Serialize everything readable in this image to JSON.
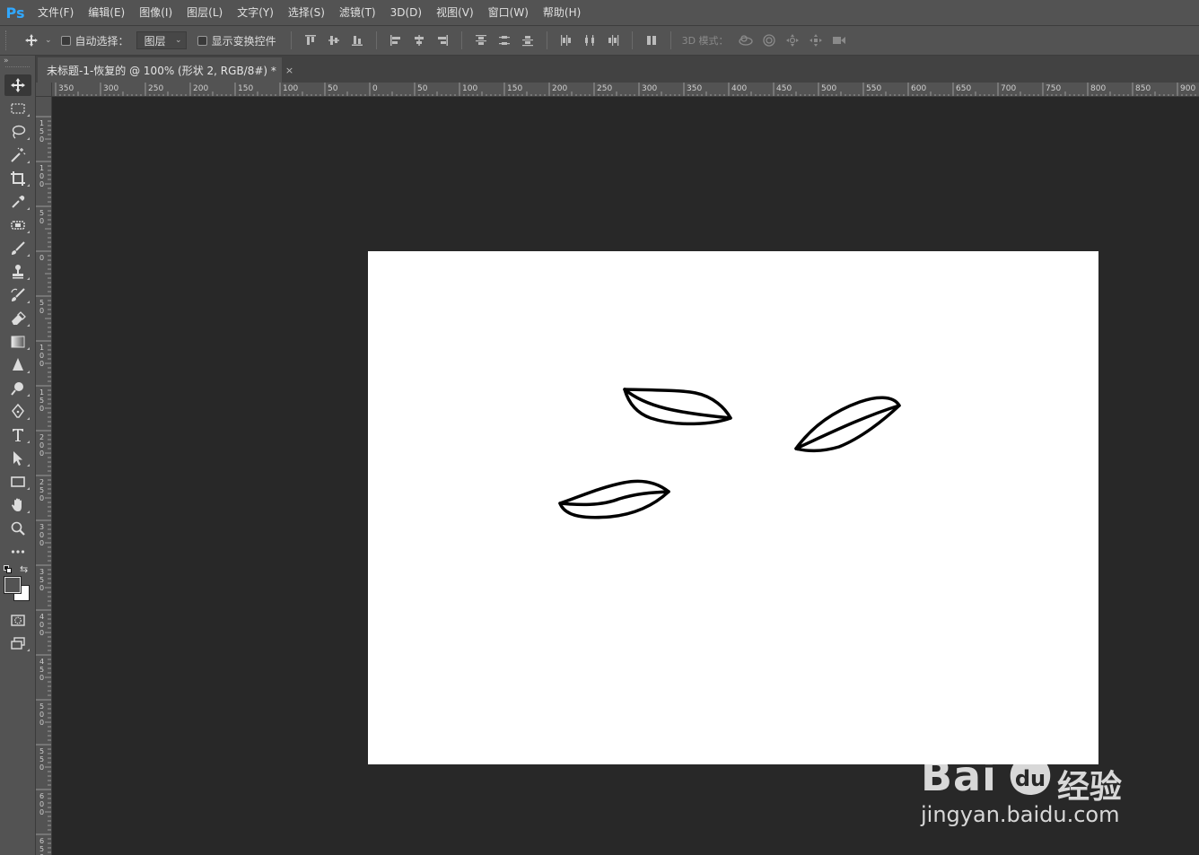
{
  "app": {
    "logo": "Ps"
  },
  "menu": [
    "文件(F)",
    "编辑(E)",
    "图像(I)",
    "图层(L)",
    "文字(Y)",
    "选择(S)",
    "滤镜(T)",
    "3D(D)",
    "视图(V)",
    "窗口(W)",
    "帮助(H)"
  ],
  "options": {
    "auto_select_label": "自动选择：",
    "auto_select_value": "图层",
    "show_transform_label": "显示变换控件",
    "mode_3d_label": "3D 模式："
  },
  "document_tab": {
    "title": "未标题-1-恢复的 @ 100% (形状 2, RGB/8#) *",
    "close": "×"
  },
  "ruler": {
    "h_labels": [
      "350",
      "300",
      "250",
      "200",
      "150",
      "100",
      "50",
      "0",
      "50",
      "100",
      "150",
      "200",
      "250",
      "300",
      "350",
      "400",
      "450",
      "500",
      "550",
      "600",
      "650",
      "700",
      "750",
      "800",
      "850",
      "900"
    ],
    "v_labels": [
      "150",
      "100",
      "50",
      "0",
      "50",
      "100",
      "150",
      "200",
      "250",
      "300",
      "350",
      "400",
      "450",
      "500",
      "550",
      "600",
      "650"
    ]
  },
  "toolbar": {
    "tools": [
      "move-tool",
      "rectangular-marquee-tool",
      "lasso-tool",
      "magic-wand-tool",
      "crop-tool",
      "eyedropper-tool",
      "spot-healing-tool",
      "brush-tool",
      "clone-stamp-tool",
      "history-brush-tool",
      "eraser-tool",
      "gradient-tool",
      "blur-tool",
      "dodge-tool",
      "pen-tool",
      "type-tool",
      "path-selection-tool",
      "rectangle-tool",
      "hand-tool",
      "zoom-tool",
      "more-tools"
    ],
    "active_tool": "move-tool",
    "foreground_color": "#535353",
    "background_color": "#ffffff"
  },
  "canvas": {
    "background": "#ffffff",
    "shapes": [
      "leaf-shape-1",
      "leaf-shape-2",
      "leaf-shape-3"
    ]
  },
  "watermark": {
    "brand": "Bai",
    "brand_cn": "经验",
    "url": "jingyan.baidu.com"
  }
}
